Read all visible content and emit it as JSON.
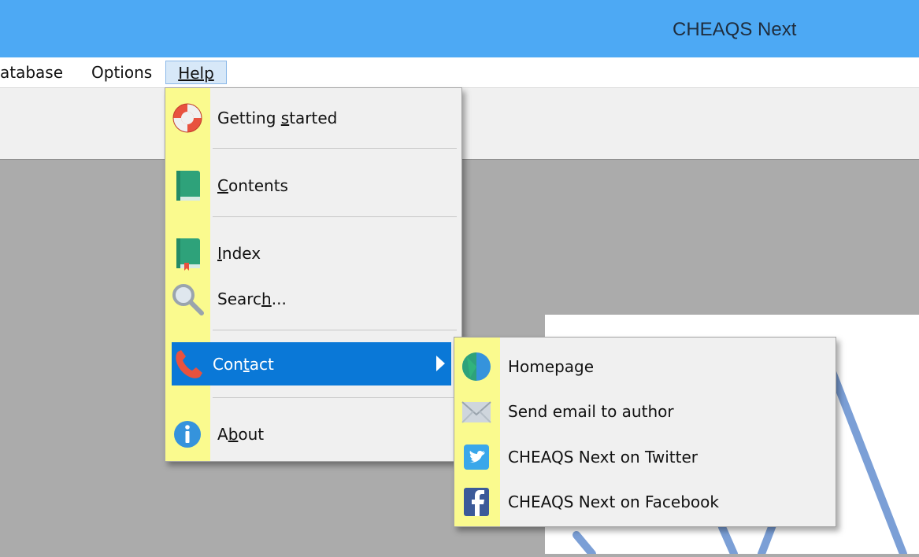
{
  "window": {
    "title": "CHEAQS Next"
  },
  "menubar": {
    "items": [
      {
        "label": "atabase"
      },
      {
        "label": "Options"
      },
      {
        "label": "Help"
      }
    ]
  },
  "help_menu": {
    "getting_started": {
      "pre": "Getting ",
      "u": "s",
      "post": "tarted"
    },
    "contents": {
      "pre": "",
      "u": "C",
      "post": "ontents"
    },
    "index": {
      "pre": "",
      "u": "I",
      "post": "ndex"
    },
    "search": {
      "pre": "Searc",
      "u": "h",
      "post": "..."
    },
    "contact": {
      "pre": "Con",
      "u": "t",
      "post": "act"
    },
    "about": {
      "pre": "A",
      "u": "b",
      "post": "out"
    }
  },
  "contact_submenu": {
    "items": [
      {
        "label": "Homepage"
      },
      {
        "label": "Send email to author"
      },
      {
        "label": "CHEAQS Next on Twitter"
      },
      {
        "label": "CHEAQS Next on Facebook"
      }
    ]
  },
  "colors": {
    "titlebar": "#4da9f4",
    "highlight": "#0a78d7",
    "stripe": "#fafa8e"
  }
}
